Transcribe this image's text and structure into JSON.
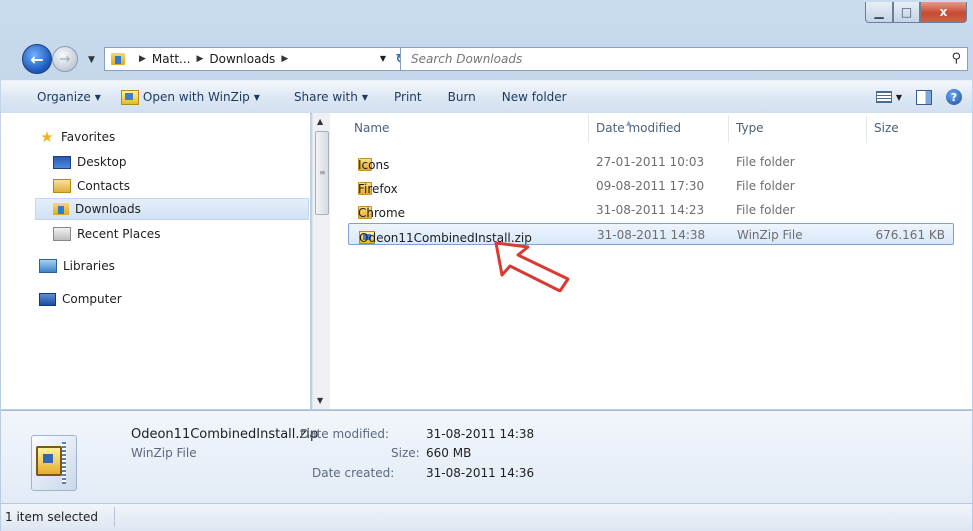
{
  "window": {
    "minimize_glyph": "▁",
    "maximize_glyph": "□",
    "close_glyph": "x"
  },
  "address": {
    "crumbs": [
      "Matt...",
      "Downloads"
    ],
    "search_placeholder": "Search Downloads"
  },
  "toolbar": {
    "organize": "Organize",
    "open_with": "Open with WinZip",
    "share_with": "Share with",
    "print": "Print",
    "burn": "Burn",
    "new_folder": "New folder"
  },
  "nav": {
    "favorites": "Favorites",
    "desktop": "Desktop",
    "contacts": "Contacts",
    "downloads": "Downloads",
    "recent": "Recent Places",
    "libraries": "Libraries",
    "computer": "Computer"
  },
  "columns": {
    "name": "Name",
    "date": "Date modified",
    "type": "Type",
    "size": "Size"
  },
  "files": [
    {
      "name": "Icons",
      "date": "27-01-2011 10:03",
      "type": "File folder",
      "size": ""
    },
    {
      "name": "Firefox",
      "date": "09-08-2011 17:30",
      "type": "File folder",
      "size": ""
    },
    {
      "name": "Chrome",
      "date": "31-08-2011 14:23",
      "type": "File folder",
      "size": ""
    },
    {
      "name": "Odeon11CombinedInstall.zip",
      "date": "31-08-2011 14:38",
      "type": "WinZip File",
      "size": "676.161 KB"
    }
  ],
  "details": {
    "name": "Odeon11CombinedInstall.zip",
    "type": "WinZip File",
    "modified_label": "Date modified:",
    "modified_value": "31-08-2011 14:38",
    "size_label": "Size:",
    "size_value": "660 MB",
    "created_label": "Date created:",
    "created_value": "31-08-2011 14:36"
  },
  "status": {
    "text": "1 item selected"
  }
}
